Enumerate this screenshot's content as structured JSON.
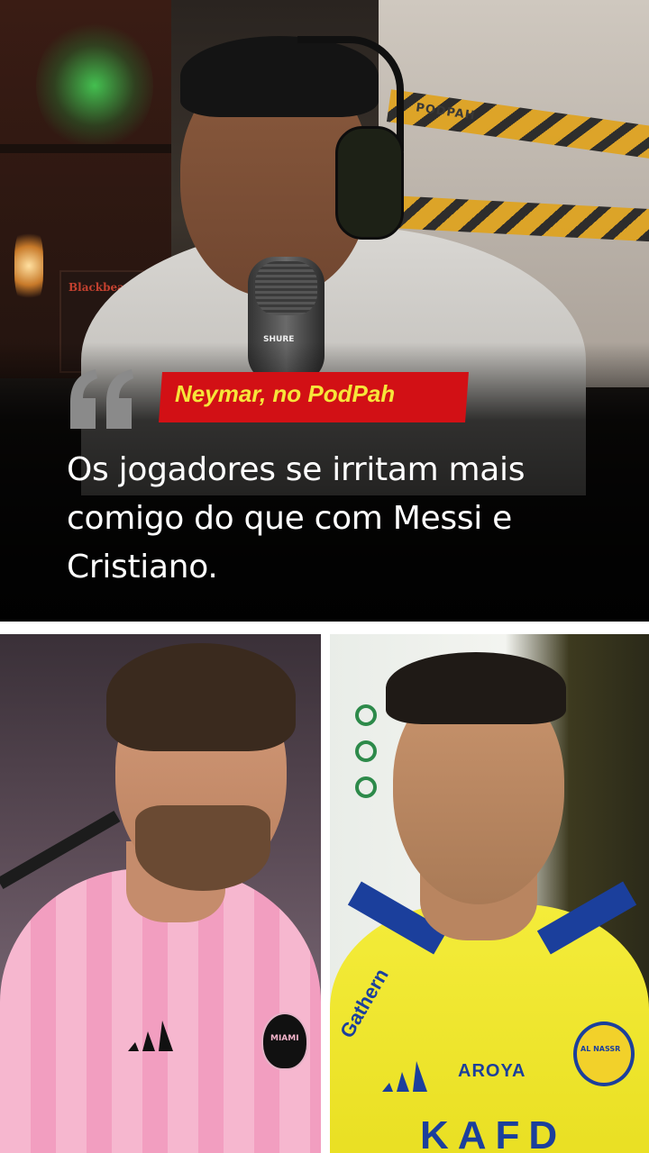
{
  "post": {
    "label": "Neymar, no PodPah",
    "quote": "Os jogadores se irritam mais comigo do que com Messi e Cristiano."
  },
  "studio": {
    "tape_text": "PODPAH",
    "mic_brand": "SHURE",
    "book_title": "Blackbeard"
  },
  "photo_left": {
    "crest_text": "MIAMI"
  },
  "photo_right": {
    "sponsor": "AROYA",
    "sleeve": "Gathern",
    "crest_text": "AL NASSR",
    "shirt_text": "KAFD"
  },
  "colors": {
    "label_bg": "#d21015",
    "label_text": "#f6e53a",
    "quote_text": "#ffffff",
    "overlay": "#000000"
  }
}
